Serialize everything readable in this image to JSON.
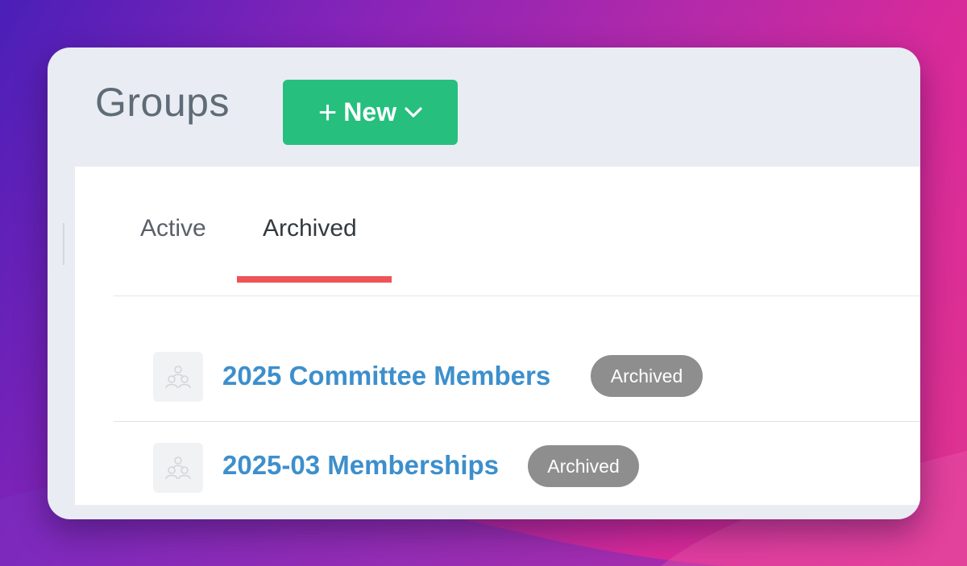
{
  "page": {
    "title": "Groups"
  },
  "new_button": {
    "label": "New",
    "icon": "plus-icon",
    "dropdown_icon": "chevron-down-icon",
    "color": "#26bf7e"
  },
  "tabs": [
    {
      "label": "Active",
      "selected": false
    },
    {
      "label": "Archived",
      "selected": true
    }
  ],
  "tab_indicator_color": "#ee5356",
  "groups": [
    {
      "name": "2025 Committee Members",
      "status": "Archived",
      "icon": "group-icon"
    },
    {
      "name": "2025-03 Memberships",
      "status": "Archived",
      "icon": "group-icon"
    }
  ],
  "colors": {
    "link": "#3d8fcc",
    "badge": "#8e8e8e"
  }
}
